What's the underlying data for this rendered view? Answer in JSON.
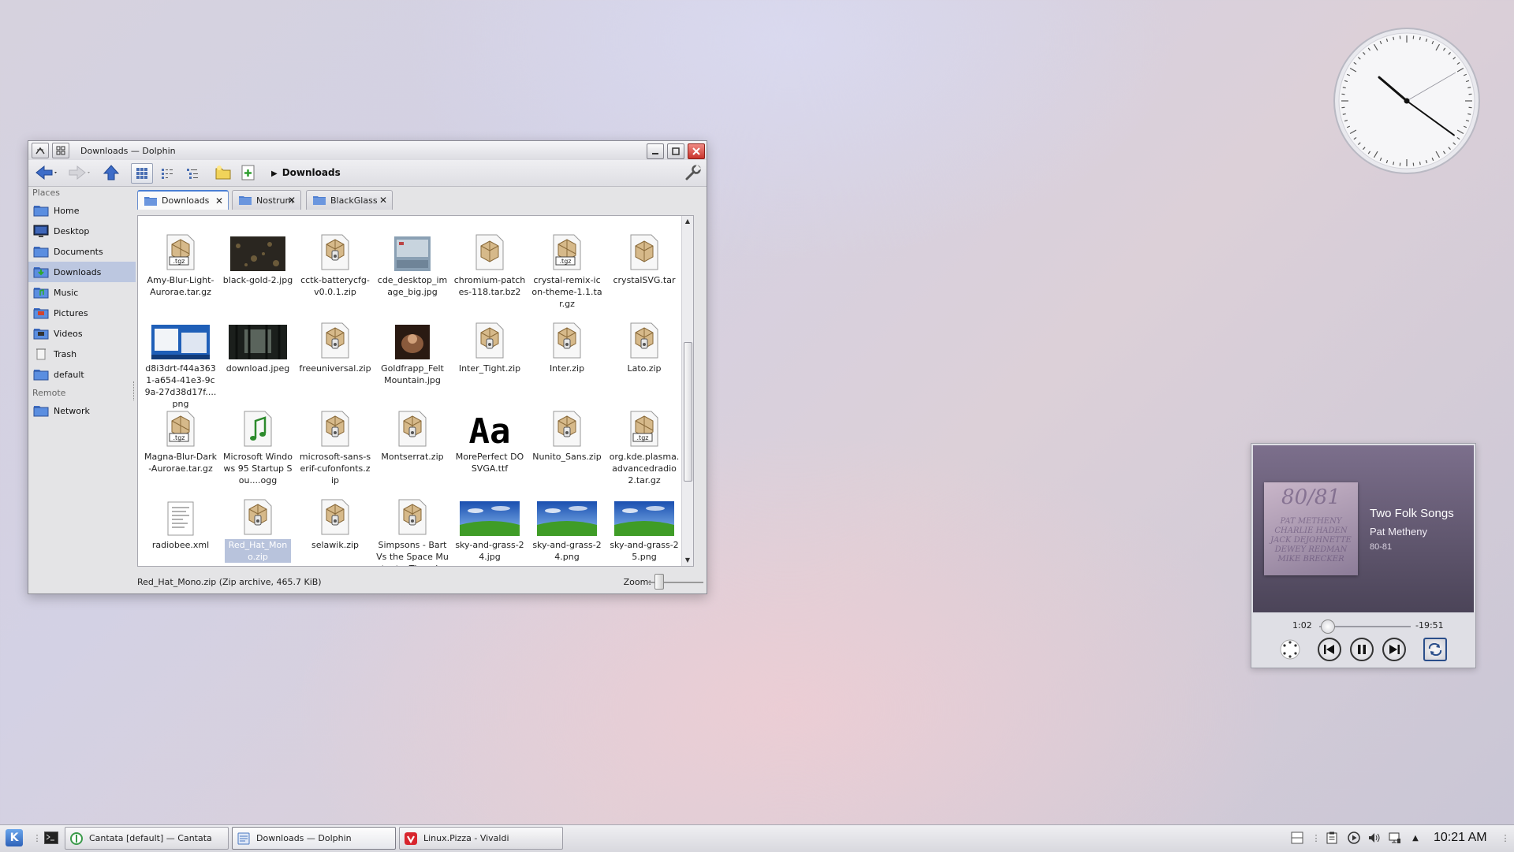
{
  "window": {
    "title": "Downloads — Dolphin",
    "breadcrumb": "Downloads",
    "status": "Red_Hat_Mono.zip (Zip archive, 465.7 KiB)",
    "zoom_label": "Zoom:"
  },
  "places": {
    "header_places": "Places",
    "items": [
      {
        "label": "Home",
        "icon": "home-folder-icon"
      },
      {
        "label": "Desktop",
        "icon": "desktop-icon"
      },
      {
        "label": "Documents",
        "icon": "documents-folder-icon"
      },
      {
        "label": "Downloads",
        "icon": "downloads-folder-icon"
      },
      {
        "label": "Music",
        "icon": "music-folder-icon"
      },
      {
        "label": "Pictures",
        "icon": "pictures-folder-icon"
      },
      {
        "label": "Videos",
        "icon": "videos-folder-icon"
      },
      {
        "label": "Trash",
        "icon": "trash-icon"
      },
      {
        "label": "default",
        "icon": "folder-icon"
      }
    ],
    "header_remote": "Remote",
    "remote_items": [
      {
        "label": "Network",
        "icon": "network-folder-icon"
      }
    ]
  },
  "tabs": [
    {
      "label": "Downloads"
    },
    {
      "label": "Nostrum"
    },
    {
      "label": "BlackGlass"
    }
  ],
  "files": [
    {
      "name": "Amy-Blur-Light-Aurorae.tar.gz",
      "kind": "tgz"
    },
    {
      "name": "black-gold-2.jpg",
      "kind": "img-dark"
    },
    {
      "name": "cctk-batterycfg-v0.0.1.zip",
      "kind": "zip"
    },
    {
      "name": "cde_desktop_image_big.jpg",
      "kind": "img-cde"
    },
    {
      "name": "chromium-patches-118.tar.bz2",
      "kind": "box"
    },
    {
      "name": "crystal-remix-icon-theme-1.1.tar.gz",
      "kind": "tgz"
    },
    {
      "name": "crystalSVG.tar",
      "kind": "box"
    },
    {
      "name": "d8i3drt-f44a3631-a654-41e3-9c9a-27d38d17f....png",
      "kind": "img-screen"
    },
    {
      "name": "download.jpeg",
      "kind": "img-forest"
    },
    {
      "name": "freeuniversal.zip",
      "kind": "zip"
    },
    {
      "name": "Goldfrapp_Felt Mountain.jpg",
      "kind": "img-album"
    },
    {
      "name": "Inter_Tight.zip",
      "kind": "zip"
    },
    {
      "name": "Inter.zip",
      "kind": "zip"
    },
    {
      "name": "Lato.zip",
      "kind": "zip"
    },
    {
      "name": "Magna-Blur-Dark-Aurorae.tar.gz",
      "kind": "tgz"
    },
    {
      "name": "Microsoft Windows 95 Startup Sou....ogg",
      "kind": "audio"
    },
    {
      "name": "microsoft-sans-serif-cufonfonts.zip",
      "kind": "zip"
    },
    {
      "name": "Montserrat.zip",
      "kind": "zip"
    },
    {
      "name": "MorePerfect DOSVGA.ttf",
      "kind": "font"
    },
    {
      "name": "Nunito_Sans.zip",
      "kind": "zip"
    },
    {
      "name": "org.kde.plasma.advancedradio2.tar.gz",
      "kind": "tgz"
    },
    {
      "name": "radiobee.xml",
      "kind": "text"
    },
    {
      "name": "Red_Hat_Mono.zip",
      "kind": "zip",
      "selected": true
    },
    {
      "name": "selawik.zip",
      "kind": "zip"
    },
    {
      "name": "Simpsons - Bart Vs the Space Mutants. Th....zip",
      "kind": "zip"
    },
    {
      "name": "sky-and-grass-24.jpg",
      "kind": "img-sky"
    },
    {
      "name": "sky-and-grass-24.png",
      "kind": "img-sky"
    },
    {
      "name": "sky-and-grass-25.png",
      "kind": "img-sky"
    }
  ],
  "font_preview_text": "Aa",
  "tgz_badge": ".tgz",
  "player": {
    "title": "Two Folk Songs",
    "artist": "Pat Metheny",
    "album": "80-81",
    "elapsed": "1:02",
    "remaining": "-19:51",
    "progress": 0.05
  },
  "taskbar": {
    "tasks": [
      {
        "label": "Cantata [default] — Cantata",
        "icon": "cantata-icon"
      },
      {
        "label": "Downloads — Dolphin",
        "icon": "dolphin-icon",
        "active": true
      },
      {
        "label": "Linux.Pizza - Vivaldi",
        "icon": "vivaldi-icon"
      }
    ],
    "clock": "10:21 AM"
  },
  "clock_widget": {
    "hour": 10,
    "minute": 21
  }
}
